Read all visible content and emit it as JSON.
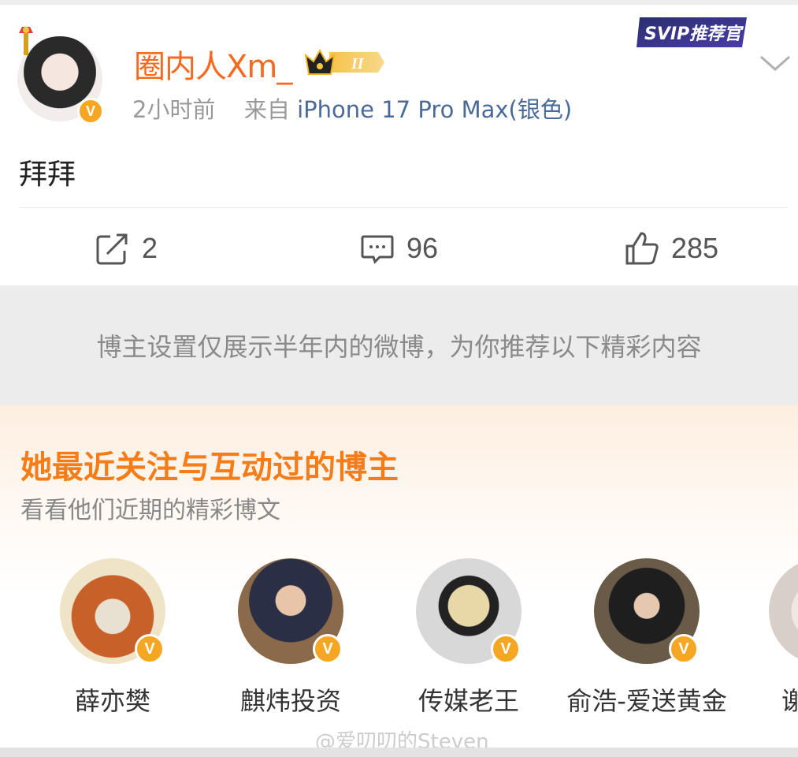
{
  "post": {
    "username": "圈内人Xm_",
    "level_badge": "II",
    "time": "2小时前",
    "from_prefix": "来自",
    "source": "iPhone 17 Pro Max(银色)",
    "svip_label": "SVIP推荐官",
    "text": "拜拜",
    "actions": {
      "repost_count": "2",
      "comment_count": "96",
      "like_count": "285"
    },
    "verified_mark": "V"
  },
  "notice": {
    "text": "博主设置仅展示半年内的微博，为你推荐以下精彩内容"
  },
  "recommend": {
    "title": "她最近关注与互动过的博主",
    "subtitle": "看看他们近期的精彩博文",
    "bloggers": [
      {
        "name": "薛亦樊"
      },
      {
        "name": "麒炜投资"
      },
      {
        "name": "传媒老王"
      },
      {
        "name": "俞浩-爱送黄金"
      },
      {
        "name": "谢"
      }
    ]
  },
  "watermark": "@爱叨叨的Steven",
  "colors": {
    "username": "#f56a1f",
    "rec_title": "#f57c16",
    "verified": "#f5a623",
    "source_link": "#4a6a9a"
  }
}
